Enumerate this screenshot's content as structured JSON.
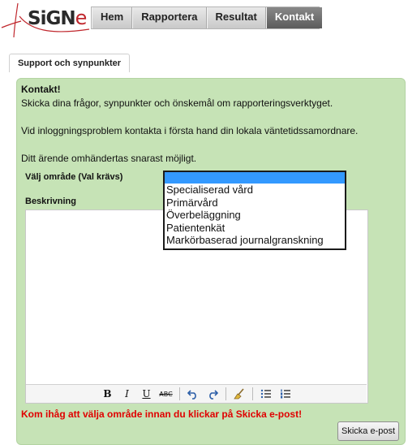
{
  "logo": {
    "text": "SiGN",
    "accent": "e"
  },
  "nav": {
    "items": [
      "Hem",
      "Rapportera",
      "Resultat",
      "Kontakt"
    ],
    "active": "Kontakt"
  },
  "tab": {
    "label": "Support och synpunkter"
  },
  "panel": {
    "title": "Kontakt!",
    "line1": "Skicka dina frågor, synpunkter och önskemål om rapporteringsverktyget.",
    "line2": "Vid inloggningsproblem kontakta i första hand din lokala väntetidssamordnare.",
    "line3": "Ditt ärende omhändertas snarast möjligt."
  },
  "form": {
    "area_label": "Välj område (Val krävs)",
    "area_selected": "",
    "area_options": [
      "Specialiserad vård",
      "Primärvård",
      "Överbeläggning",
      "Patientenkät",
      "Markörbaserad journalgranskning"
    ],
    "description_label": "Beskrivning",
    "warning": "Kom ihåg att välja område innan du klickar på Skicka e-post!",
    "send_label": "Skicka e-post"
  },
  "toolbar": {
    "bold": "B",
    "italic": "I",
    "underline": "U",
    "strike": "ABC"
  },
  "colors": {
    "panel_bg": "#c6e3b6",
    "warning": "#e00000",
    "nav_active": "#6e6e6e",
    "logo_accent": "#c0272d"
  }
}
